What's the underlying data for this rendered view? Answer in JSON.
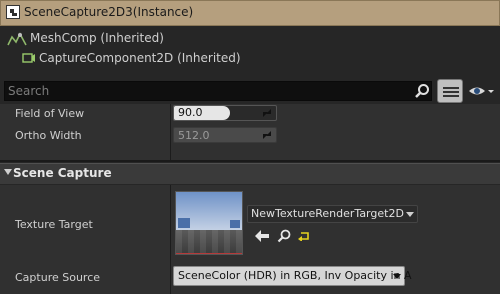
{
  "header": {
    "title": "SceneCapture2D3(Instance)"
  },
  "tree": {
    "items": [
      {
        "label": "MeshComp (Inherited)",
        "icon": "mesh-component-icon"
      },
      {
        "label": "CaptureComponent2D (Inherited)",
        "icon": "capture-component-icon"
      }
    ]
  },
  "search": {
    "placeholder": "Search"
  },
  "properties": {
    "field_of_view": {
      "label": "Field of View",
      "value": "90.0"
    },
    "ortho_width": {
      "label": "Ortho Width",
      "value": "512.0"
    }
  },
  "scene_capture": {
    "title": "Scene Capture",
    "texture_target": {
      "label": "Texture Target",
      "value": "NewTextureRenderTarget2D"
    },
    "capture_source": {
      "label": "Capture Source",
      "value": "SceneColor (HDR) in RGB, Inv Opacity in A"
    }
  },
  "colors": {
    "header_bg": "#b59f7e",
    "panel_bg": "#303030",
    "accent_reset": "#e6d21f"
  }
}
